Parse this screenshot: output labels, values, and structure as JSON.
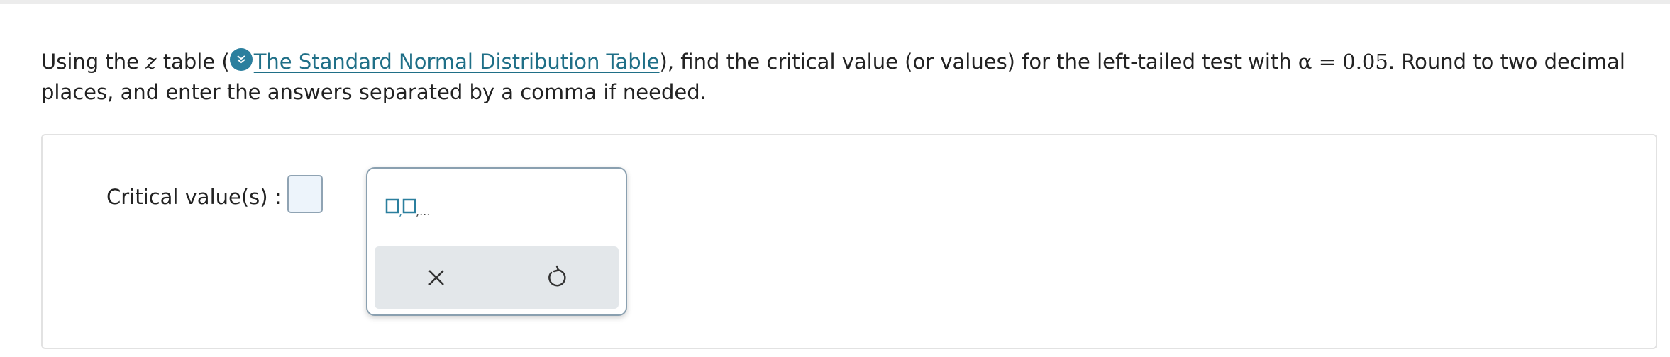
{
  "question": {
    "text_before_var": "Using the ",
    "var_z": "z",
    "text_after_var": " table (",
    "link_text": "The Standard Normal Distribution Table",
    "text_after_link": "), find the critical value (or values) for the left-tailed test with ",
    "alpha_expr": "α = 0.05",
    "text_end": ". Round to two decimal places, and enter the answers separated by a comma if needed."
  },
  "answer": {
    "label": "Critical value(s) :",
    "input_value": ""
  },
  "palette": {
    "template_text": "□,□,...",
    "icons": {
      "template": "list-template-icon",
      "clear": "close-icon",
      "undo": "undo-icon"
    }
  },
  "colors": {
    "link": "#1f6f87",
    "link_icon_bg": "#2b7f9e",
    "template_icon": "#2b7f9e",
    "input_border": "#8fa3b3",
    "input_bg": "#edf4fb",
    "palette_footer": "#e3e7ea"
  }
}
